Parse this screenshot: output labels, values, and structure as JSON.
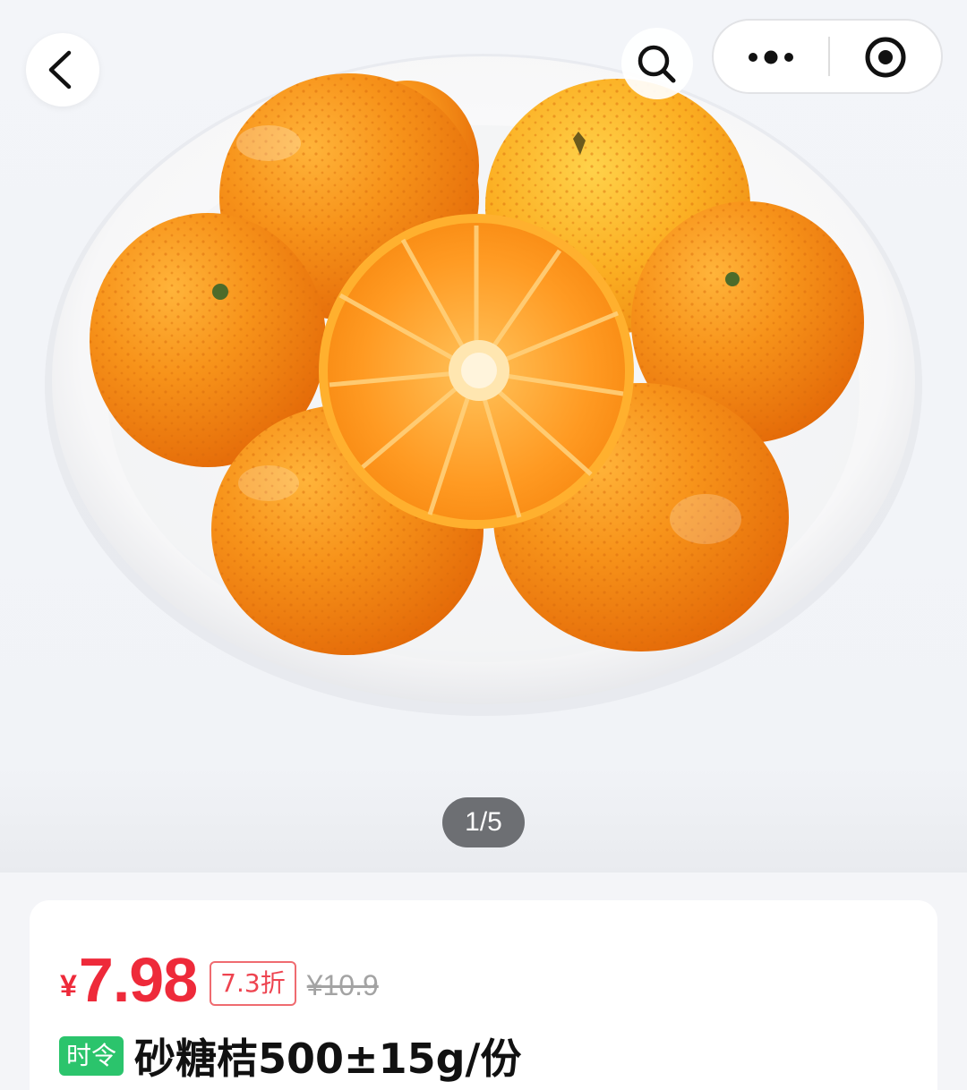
{
  "gallery": {
    "image_subject": "mandarin-oranges-in-white-bowl",
    "pager_text": "1/5",
    "current_index": 1,
    "total_images": 5
  },
  "topbar": {
    "back_icon": "chevron-left-icon",
    "search_icon": "search-icon",
    "more_icon": "more-dots-icon",
    "close_icon": "target-close-icon"
  },
  "product": {
    "currency": "¥",
    "price": "7.98",
    "discount": "7.3折",
    "original_price": "¥10.9",
    "tag": "时令",
    "title": "砂糖桔500±15g/份"
  },
  "colors": {
    "price_red": "#ee2a3a",
    "tag_green": "#2bc46c",
    "page_bg": "#f4f5f8"
  }
}
